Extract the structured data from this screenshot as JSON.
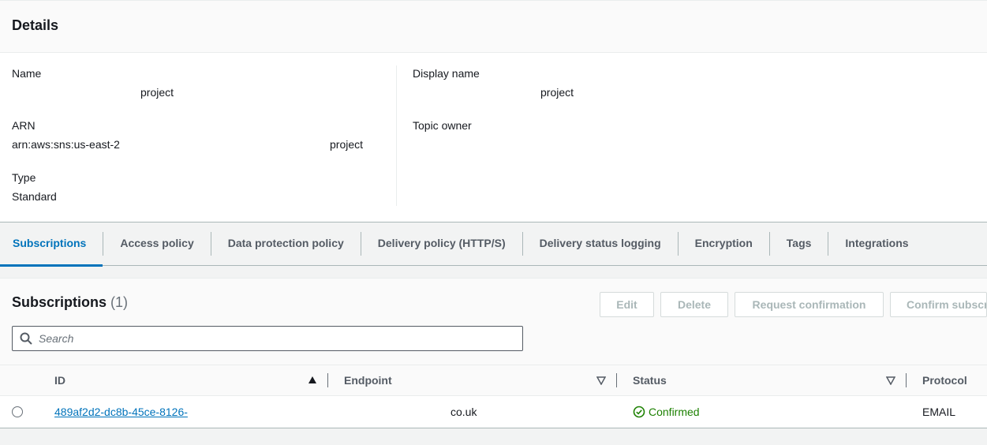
{
  "details": {
    "title": "Details",
    "left": [
      {
        "label": "Name",
        "value": "project",
        "value_prefix": ""
      },
      {
        "label": "ARN",
        "value": "project",
        "value_prefix": "arn:aws:sns:us-east-2"
      },
      {
        "label": "Type",
        "value": "Standard",
        "value_prefix": ""
      }
    ],
    "right": [
      {
        "label": "Display name",
        "value": "project"
      },
      {
        "label": "Topic owner",
        "value": ""
      }
    ]
  },
  "tabs": [
    {
      "label": "Subscriptions",
      "active": true
    },
    {
      "label": "Access policy"
    },
    {
      "label": "Data protection policy"
    },
    {
      "label": "Delivery policy (HTTP/S)"
    },
    {
      "label": "Delivery status logging"
    },
    {
      "label": "Encryption"
    },
    {
      "label": "Tags"
    },
    {
      "label": "Integrations"
    }
  ],
  "subscriptions": {
    "title": "Subscriptions",
    "count": "(1)",
    "buttons": {
      "edit": "Edit",
      "delete": "Delete",
      "request_confirmation": "Request confirmation",
      "confirm_subscription": "Confirm subscription"
    },
    "search_placeholder": "Search",
    "columns": {
      "id": "ID",
      "endpoint": "Endpoint",
      "status": "Status",
      "protocol": "Protocol"
    },
    "rows": [
      {
        "id": "489af2d2-dc8b-45ce-8126-",
        "endpoint": "co.uk",
        "status": "Confirmed",
        "protocol": "EMAIL"
      }
    ]
  },
  "colors": {
    "accent": "#0073bb",
    "success": "#1d8102",
    "disabled_text": "#aab7b8"
  },
  "icons": {
    "search": "search-icon",
    "sort_asc": "sort-ascending-icon",
    "sort_desc": "sort-descending-icon",
    "status_ok": "check-circle-icon"
  }
}
